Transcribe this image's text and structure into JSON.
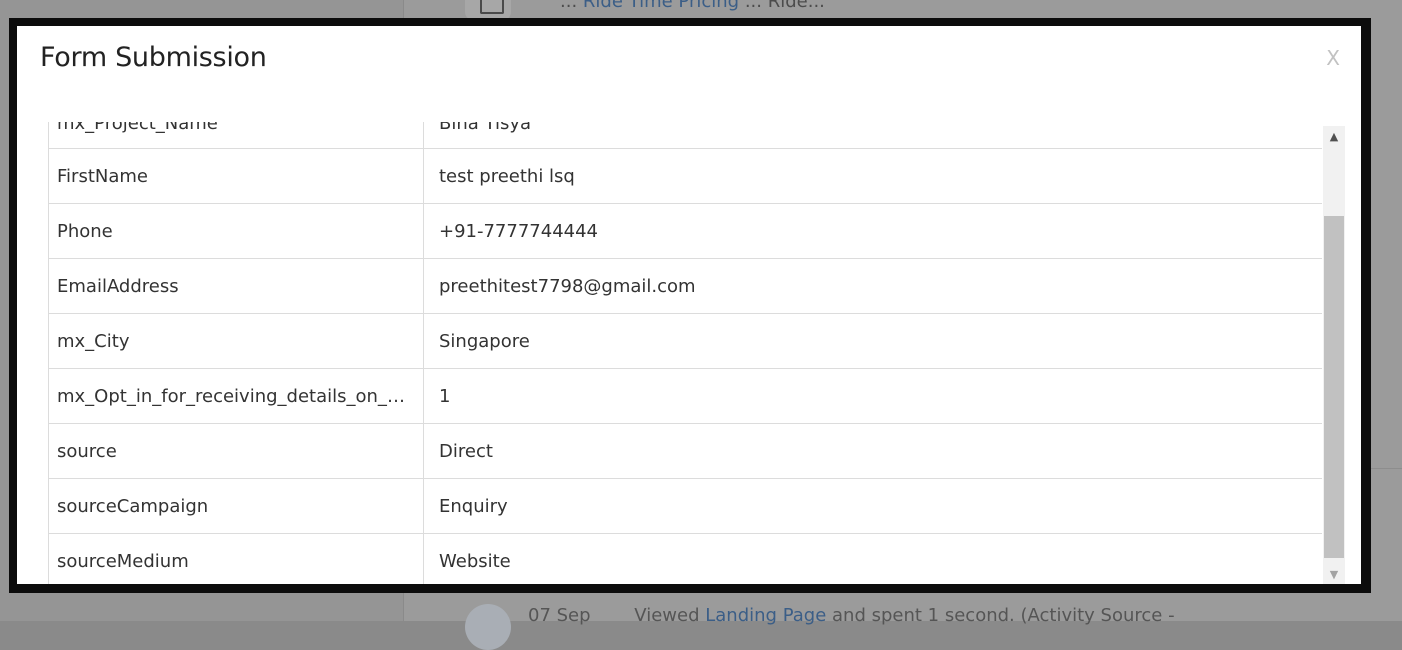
{
  "background": {
    "top_text_prefix": "...",
    "top_text_link": "Ride Time Pricing",
    "top_text_suffix": "... Ride...",
    "bottom_date": "07 Sep",
    "bottom_text_prefix": "Viewed",
    "bottom_link": "Landing Page",
    "bottom_text_suffix": "and spent 1 second. (Activity Source -"
  },
  "modal": {
    "title": "Form Submission",
    "close_label": "X",
    "rows": [
      {
        "key": "mx_Project_Name",
        "value": "Bina Tisya"
      },
      {
        "key": "FirstName",
        "value": "test preethi lsq"
      },
      {
        "key": "Phone",
        "value": "+91-7777744444"
      },
      {
        "key": "EmailAddress",
        "value": "preethitest7798@gmail.com"
      },
      {
        "key": "mx_City",
        "value": "Singapore"
      },
      {
        "key": "mx_Opt_in_for_receiving_details_on_WhatsApp",
        "value": "1"
      },
      {
        "key": "source",
        "value": "Direct"
      },
      {
        "key": "sourceCampaign",
        "value": "Enquiry"
      },
      {
        "key": "sourceMedium",
        "value": "Website"
      }
    ]
  },
  "icons": {
    "scroll_up": "▲",
    "scroll_down": "▼"
  }
}
